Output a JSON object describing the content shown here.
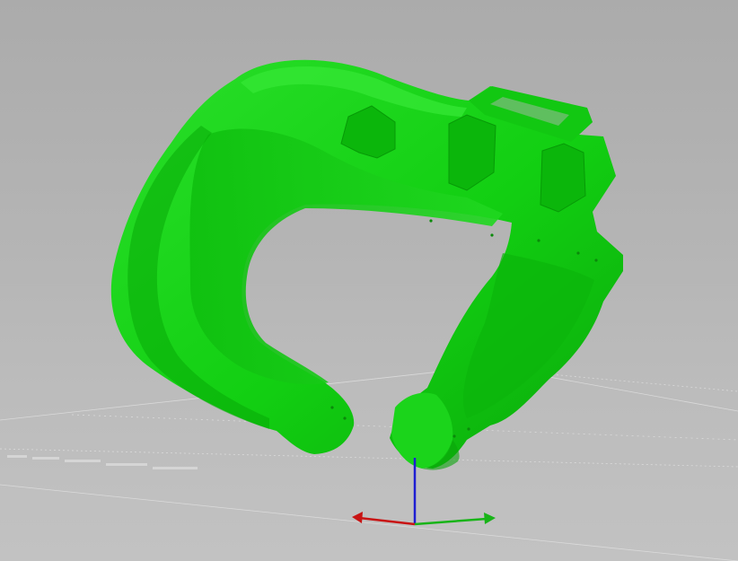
{
  "viewport": {
    "background_top": "#ababab",
    "background_bottom": "#c2c2c2",
    "bed_grid_color": "#e6e6e6",
    "bed_label": "",
    "model": {
      "name": "",
      "color": "#10d010",
      "shadow_color": "#07a207",
      "highlight_color": "#3ae83a"
    },
    "axes": {
      "x_color": "#c81414",
      "y_color": "#18b418",
      "z_color": "#1e1ed2"
    }
  }
}
